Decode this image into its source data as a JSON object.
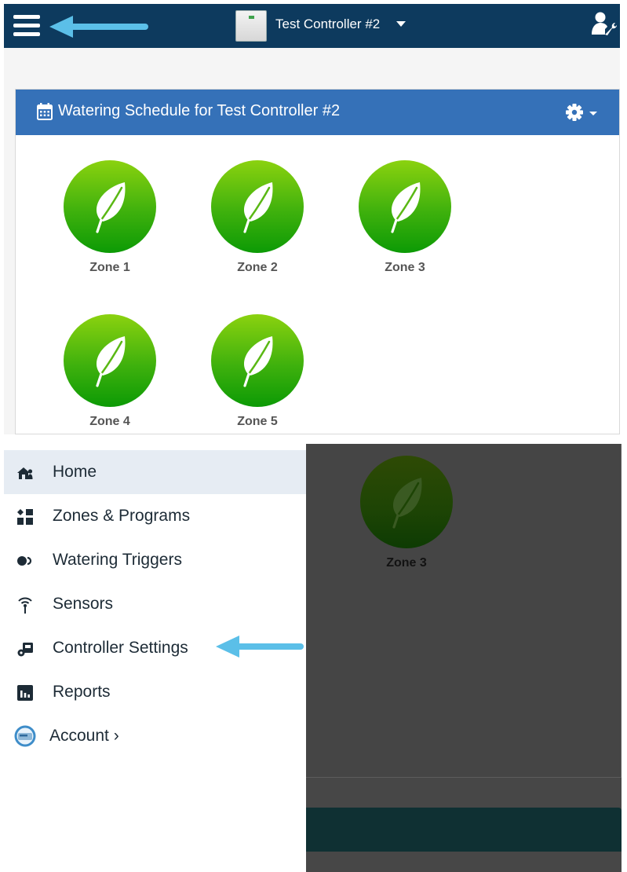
{
  "header": {
    "controller_name": "Test Controller #2"
  },
  "schedule": {
    "title": "Watering Schedule for Test Controller #2",
    "zones": [
      "Zone 1",
      "Zone 2",
      "Zone 3",
      "Zone 4",
      "Zone 5"
    ]
  },
  "drawer": {
    "items": [
      {
        "label": "Home",
        "icon": "home-icon",
        "active": true
      },
      {
        "label": "Zones & Programs",
        "icon": "zones-icon"
      },
      {
        "label": "Watering Triggers",
        "icon": "triggers-icon"
      },
      {
        "label": "Sensors",
        "icon": "sensor-icon"
      },
      {
        "label": "Controller Settings",
        "icon": "controller-settings-icon"
      },
      {
        "label": "Reports",
        "icon": "reports-icon"
      },
      {
        "label": "Account ›",
        "icon": "account-avatar-icon"
      }
    ]
  },
  "background": {
    "zone_label": "Zone 3"
  },
  "colors": {
    "topbar": "#0d3a5e",
    "card_header": "#3571b8",
    "zone_green": "#3fb10d",
    "annotation_arrow": "#5bbfe8",
    "drawer_active": "#e6ecf3"
  }
}
